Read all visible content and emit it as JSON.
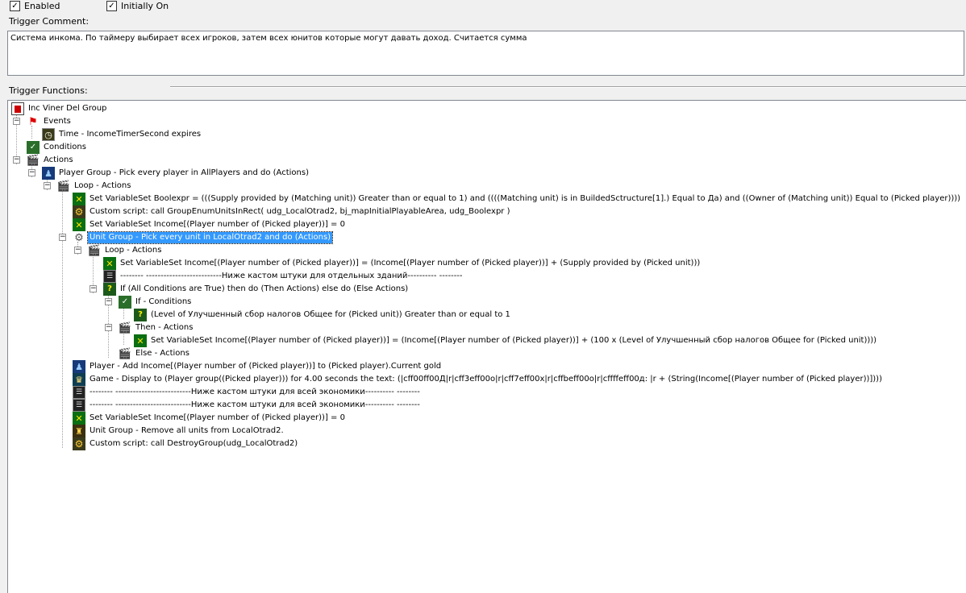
{
  "header": {
    "enabled_label": "Enabled",
    "initially_on_label": "Initially On",
    "trigger_comment_label": "Trigger Comment:",
    "trigger_functions_label": "Trigger Functions:",
    "comment_text": "Система инкома. По таймеру выбирает всех игроков, затем всех юнитов которые могут давать доход. Считается сумма"
  },
  "tree": [
    {
      "text": "Inc Viner Del Group",
      "icon": "trigger-icon"
    },
    {
      "text": "Events",
      "icon": "event-flag-icon"
    },
    {
      "text": "Time - IncomeTimerSecond expires",
      "icon": "timer-icon"
    },
    {
      "text": "Conditions",
      "icon": "conditions-icon"
    },
    {
      "text": "Actions",
      "icon": "actions-icon"
    },
    {
      "text": "Player Group - Pick every player in AllPlayers and do (Actions)",
      "icon": "player-group-icon"
    },
    {
      "text": "Loop - Actions",
      "icon": "loop-icon"
    },
    {
      "text": "Set VariableSet Boolexpr = (((Supply provided by (Matching unit)) Greater than or equal to 1) and ((((Matching unit) is in BuildedSctructure[1].) Equal to Да) and ((Owner of (Matching unit)) Equal to (Picked player))))",
      "icon": "set-variable-icon"
    },
    {
      "text": "Custom script:   call GroupEnumUnitsInRect( udg_LocalOtrad2, bj_mapInitialPlayableArea, udg_Boolexpr )",
      "icon": "custom-script-icon"
    },
    {
      "text": "Set VariableSet Income[(Player number of (Picked player))] = 0",
      "icon": "set-variable-icon"
    },
    {
      "text": "Unit Group - Pick every unit in LocalOtrad2 and do (Actions)",
      "icon": "unit-group-icon"
    },
    {
      "text": "Loop - Actions",
      "icon": "loop-icon"
    },
    {
      "text": "Set VariableSet Income[(Player number of (Picked player))] = (Income[(Player number of (Picked player))] + (Supply provided by (Picked unit)))",
      "icon": "set-variable-icon"
    },
    {
      "text": "-------- --------------------------Ниже кастом штуки для отдельных зданий---------- --------",
      "icon": "comment-icon"
    },
    {
      "text": "If (All Conditions are True) then do (Then Actions) else do (Else Actions)",
      "icon": "if-question-icon"
    },
    {
      "text": "If - Conditions",
      "icon": "conditions-icon"
    },
    {
      "text": "(Level of Улучшенный сбор налогов Общее for (Picked unit)) Greater than or equal to 1",
      "icon": "question-icon"
    },
    {
      "text": "Then - Actions",
      "icon": "actions-icon"
    },
    {
      "text": "Set VariableSet Income[(Player number of (Picked player))] = (Income[(Player number of (Picked player))] + (100 x (Level of Улучшенный сбор налогов Общее for (Picked unit))))",
      "icon": "set-variable-icon"
    },
    {
      "text": "Else - Actions",
      "icon": "actions-icon"
    },
    {
      "text": "Player - Add Income[(Player number of (Picked player))] to (Picked player).Current gold",
      "icon": "player-icon"
    },
    {
      "text": "Game - Display to (Player group((Picked player))) for 4.00 seconds the text: (|cff00ff00Д|r|cff3eff00о|r|cff7eff00х|r|cffbeff00о|r|cffffeff00д: |r + (String(Income[(Player number of (Picked player))])))",
      "icon": "game-display-icon"
    },
    {
      "text": "-------- --------------------------Ниже кастом штуки для всей экономики---------- --------",
      "icon": "comment-icon"
    },
    {
      "text": "-------- --------------------------Ниже кастом штуки для всей экономики---------- --------",
      "icon": "comment-icon"
    },
    {
      "text": "Set VariableSet Income[(Player number of (Picked player))] = 0",
      "icon": "set-variable-icon"
    },
    {
      "text": "Unit Group - Remove all units from LocalOtrad2.",
      "icon": "remove-units-icon"
    },
    {
      "text": "Custom script:   call DestroyGroup(udg_LocalOtrad2)",
      "icon": "custom-script-icon"
    }
  ],
  "selected_row": 10
}
